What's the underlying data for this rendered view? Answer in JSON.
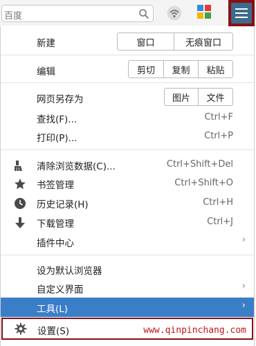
{
  "toolbar": {
    "search_text": "百度",
    "icons": [
      "search-icon",
      "wifi-icon",
      "app-grid-icon",
      "menu-icon"
    ]
  },
  "menu": {
    "new": {
      "label": "新建",
      "buttons": [
        "窗口",
        "无痕窗口"
      ]
    },
    "edit": {
      "label": "编辑",
      "buttons": [
        "剪切",
        "复制",
        "粘贴"
      ]
    },
    "save_as": {
      "label": "网页另存为",
      "buttons": [
        "图片",
        "文件"
      ]
    },
    "find": {
      "label": "查找(F)...",
      "shortcut": "Ctrl+F"
    },
    "print": {
      "label": "打印(P)...",
      "shortcut": "Ctrl+P"
    },
    "clear_data": {
      "label": "清除浏览数据(C)...",
      "shortcut": "Ctrl+Shift+Del"
    },
    "bookmarks": {
      "label": "书签管理",
      "shortcut": "Ctrl+Shift+O"
    },
    "history": {
      "label": "历史记录(H)",
      "shortcut": "Ctrl+H"
    },
    "downloads": {
      "label": "下载管理",
      "shortcut": "Ctrl+J"
    },
    "plugins": {
      "label": "插件中心"
    },
    "default_browser": {
      "label": "设为默认浏览器"
    },
    "customize": {
      "label": "自定义界面"
    },
    "tools": {
      "label": "工具(L)"
    },
    "settings": {
      "label": "设置(S)"
    }
  },
  "watermark": "www.qinpinchang.com",
  "colors": {
    "highlight": "#3b7ec8",
    "frame": "#8a0f14"
  }
}
